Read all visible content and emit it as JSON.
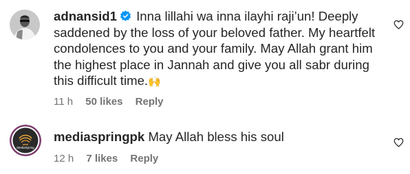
{
  "comments": [
    {
      "username": "adnansid1",
      "verified": true,
      "text": "Inna lillahi wa inna ilayhi raji’un! Deeply saddened by the loss of your beloved father. My heartfelt condolences to you and your family. May Allah grant him the highest place in Jannah and give you all sabr during this difficult time.",
      "emoji": "🙌",
      "time": "11 h",
      "likes": "50 likes",
      "reply": "Reply"
    },
    {
      "username": "mediaspringpk",
      "verified": false,
      "text": "May Allah bless his soul",
      "time": "12 h",
      "likes": "7 likes",
      "reply": "Reply",
      "avatar_text": "MediaSpring"
    }
  ],
  "icons": {
    "verified": "verified-badge-icon",
    "like": "heart-outline-icon"
  },
  "colors": {
    "text": "#262626",
    "meta": "#737373",
    "verified": "#0095f6"
  }
}
